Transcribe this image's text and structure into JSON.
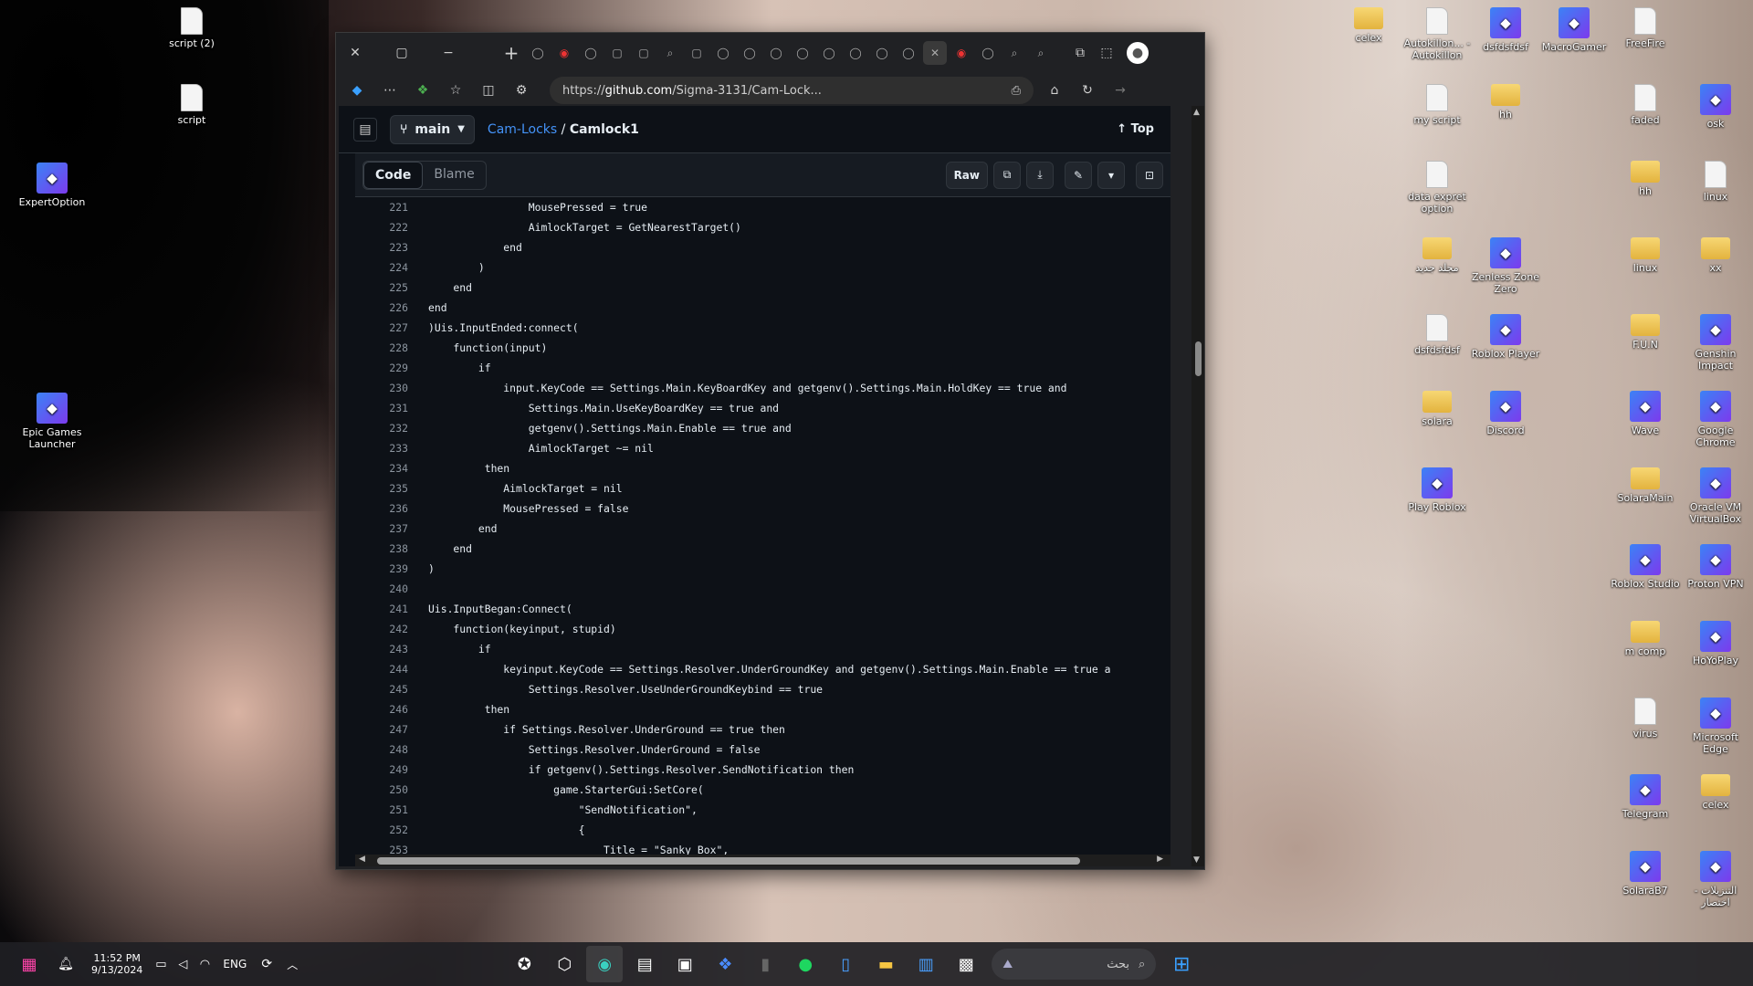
{
  "desktop_left": [
    {
      "label": "script (2)",
      "type": "doc"
    },
    {
      "label": "script",
      "type": "doc"
    },
    {
      "label": "ExpertOption",
      "type": "app"
    },
    {
      "label": "Epic Games Launcher",
      "type": "app"
    }
  ],
  "desktop_right": [
    {
      "label": "celex",
      "type": "folder"
    },
    {
      "label": "Autokillon... - Autokillon",
      "type": "doc"
    },
    {
      "label": "dsfdsfdsf",
      "type": "app"
    },
    {
      "label": "MacroGamer",
      "type": "app"
    },
    {
      "label": "FreeFire",
      "type": "doc"
    },
    {
      "label": "my script",
      "type": "doc"
    },
    {
      "label": "hh",
      "type": "folder"
    },
    {
      "label": "faded",
      "type": "doc"
    },
    {
      "label": "osk",
      "type": "app"
    },
    {
      "label": "data expret option",
      "type": "doc"
    },
    {
      "label": "hh",
      "type": "folder"
    },
    {
      "label": "linux",
      "type": "doc"
    },
    {
      "label": "مجلد جديد",
      "type": "folder"
    },
    {
      "label": "Zenless Zone Zero",
      "type": "app"
    },
    {
      "label": "linux",
      "type": "folder"
    },
    {
      "label": "xx",
      "type": "folder"
    },
    {
      "label": "dsfdsfdsf",
      "type": "doc"
    },
    {
      "label": "Roblox Player",
      "type": "app"
    },
    {
      "label": "F.U.N",
      "type": "folder"
    },
    {
      "label": "Genshin Impact",
      "type": "app"
    },
    {
      "label": "solara",
      "type": "folder"
    },
    {
      "label": "Discord",
      "type": "app"
    },
    {
      "label": "Wave",
      "type": "app"
    },
    {
      "label": "Google Chrome",
      "type": "app"
    },
    {
      "label": "Play Roblox",
      "type": "app"
    },
    {
      "label": "SolaraMain",
      "type": "folder"
    },
    {
      "label": "Oracle VM VirtualBox",
      "type": "app"
    },
    {
      "label": "Roblox Studio",
      "type": "app"
    },
    {
      "label": "Proton VPN",
      "type": "app"
    },
    {
      "label": "m comp",
      "type": "folder"
    },
    {
      "label": "HoYoPlay",
      "type": "app"
    },
    {
      "label": "virus",
      "type": "doc"
    },
    {
      "label": "Microsoft Edge",
      "type": "app"
    },
    {
      "label": "Telegram",
      "type": "app"
    },
    {
      "label": "celex",
      "type": "folder"
    },
    {
      "label": "SolaraB7",
      "type": "app"
    },
    {
      "label": "التنزيلات - اختصار",
      "type": "app"
    }
  ],
  "browser": {
    "url_prefix": "https://",
    "url_host": "github.com",
    "url_rest": "/Sigma-3131/Cam-Lock..."
  },
  "github": {
    "branch": "main",
    "repo": "Cam-Locks",
    "sep": " / ",
    "file": "Camlock1",
    "top": "Top",
    "tab_code": "Code",
    "tab_blame": "Blame",
    "raw": "Raw"
  },
  "code": [
    {
      "n": "221",
      "t": "                MousePressed = true"
    },
    {
      "n": "222",
      "t": "                AimlockTarget = GetNearestTarget()"
    },
    {
      "n": "223",
      "t": "            end"
    },
    {
      "n": "224",
      "t": "        )"
    },
    {
      "n": "225",
      "t": "    end"
    },
    {
      "n": "226",
      "t": "end"
    },
    {
      "n": "227",
      "t": ")Uis.InputEnded:connect("
    },
    {
      "n": "228",
      "t": "    function(input)"
    },
    {
      "n": "229",
      "t": "        if"
    },
    {
      "n": "230",
      "t": "            input.KeyCode == Settings.Main.KeyBoardKey and getgenv().Settings.Main.HoldKey == true and"
    },
    {
      "n": "231",
      "t": "                Settings.Main.UseKeyBoardKey == true and"
    },
    {
      "n": "232",
      "t": "                getgenv().Settings.Main.Enable == true and"
    },
    {
      "n": "233",
      "t": "                AimlockTarget ~= nil"
    },
    {
      "n": "234",
      "t": "         then"
    },
    {
      "n": "235",
      "t": "            AimlockTarget = nil"
    },
    {
      "n": "236",
      "t": "            MousePressed = false"
    },
    {
      "n": "237",
      "t": "        end"
    },
    {
      "n": "238",
      "t": "    end"
    },
    {
      "n": "239",
      "t": ")"
    },
    {
      "n": "240",
      "t": ""
    },
    {
      "n": "241",
      "t": "Uis.InputBegan:Connect("
    },
    {
      "n": "242",
      "t": "    function(keyinput, stupid)"
    },
    {
      "n": "243",
      "t": "        if"
    },
    {
      "n": "244",
      "t": "            keyinput.KeyCode == Settings.Resolver.UnderGroundKey and getgenv().Settings.Main.Enable == true a"
    },
    {
      "n": "245",
      "t": "                Settings.Resolver.UseUnderGroundKeybind == true"
    },
    {
      "n": "246",
      "t": "         then"
    },
    {
      "n": "247",
      "t": "            if Settings.Resolver.UnderGround == true then"
    },
    {
      "n": "248",
      "t": "                Settings.Resolver.UnderGround = false"
    },
    {
      "n": "249",
      "t": "                if getgenv().Settings.Resolver.SendNotification then"
    },
    {
      "n": "250",
      "t": "                    game.StarterGui:SetCore("
    },
    {
      "n": "251",
      "t": "                        \"SendNotification\","
    },
    {
      "n": "252",
      "t": "                        {"
    },
    {
      "n": "253",
      "t": "                            Title = \"Sanky Box\","
    }
  ],
  "taskbar": {
    "time": "11:52 PM",
    "date": "9/13/2024",
    "lang": "ENG",
    "search_placeholder": "بحث"
  }
}
